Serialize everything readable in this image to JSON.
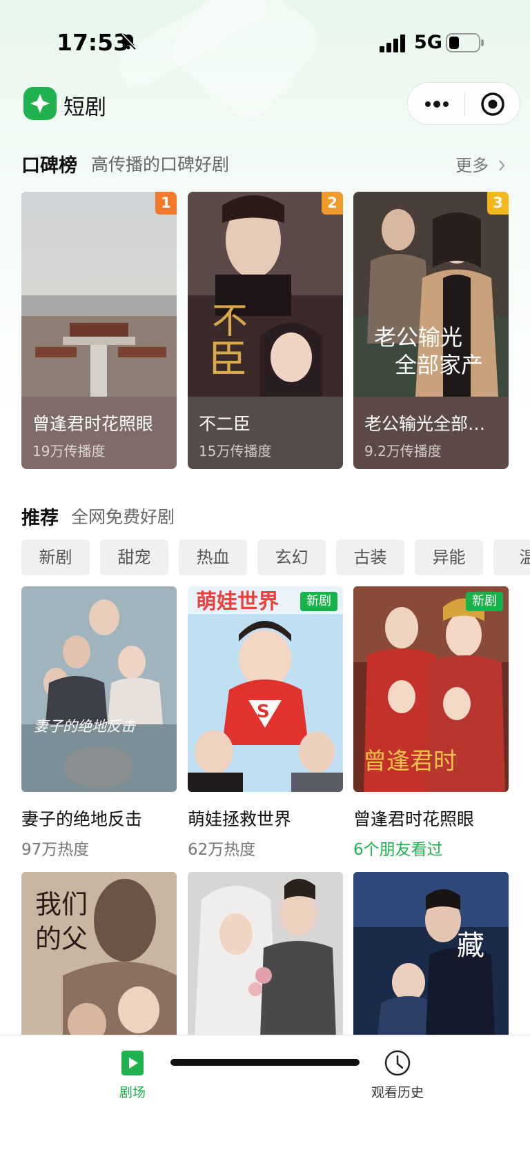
{
  "status_bar": {
    "time": "17:53",
    "network": "5G"
  },
  "app": {
    "title": "短剧"
  },
  "ranking": {
    "title": "口碑榜",
    "subtitle": "高传播的口碑好剧",
    "more_label": "更多",
    "items": [
      {
        "rank": "1",
        "title": "曾逢君时花照眼",
        "plays": "19万传播度",
        "badge_color": "#f4792a"
      },
      {
        "rank": "2",
        "title": "不二臣",
        "plays": "15万传播度",
        "badge_color": "#f39a2c"
      },
      {
        "rank": "3",
        "title": "老公输光全部家产，我让他继续",
        "plays": "9.2万传播度",
        "badge_color": "#f5b81c"
      }
    ]
  },
  "recommend": {
    "title": "推荐",
    "subtitle": "全网免费好剧",
    "chips": [
      "新剧",
      "甜宠",
      "热血",
      "玄幻",
      "古装",
      "异能",
      "温"
    ],
    "items": [
      {
        "title": "妻子的绝地反击",
        "meta": "97万热度",
        "new_tag": ""
      },
      {
        "title": "萌娃拯救世界",
        "meta": "62万热度",
        "new_tag": "新剧"
      },
      {
        "title": "曾逢君时花照眼",
        "meta": "6个朋友看过",
        "new_tag": "新剧"
      }
    ]
  },
  "tabs": [
    {
      "label": "剧场",
      "icon": "play-square-icon",
      "active": true
    },
    {
      "label": "观看历史",
      "icon": "clock-icon",
      "active": false
    }
  ],
  "colors": {
    "accent": "#1fb24f",
    "tag_green": "#17b34a"
  }
}
